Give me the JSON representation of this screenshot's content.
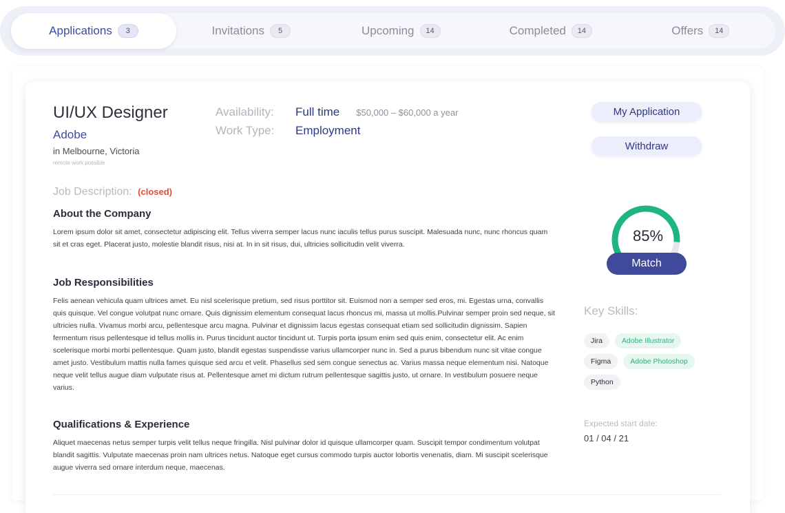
{
  "tabs": [
    {
      "label": "Applications",
      "count": "3"
    },
    {
      "label": "Invitations",
      "count": "5"
    },
    {
      "label": "Upcoming",
      "count": "14"
    },
    {
      "label": "Completed",
      "count": "14"
    },
    {
      "label": "Offers",
      "count": "14"
    }
  ],
  "job": {
    "title": "UI/UX Designer",
    "company": "Adobe",
    "location": "in Melbourne, Victoria",
    "remote_note": "remote work possible",
    "availability_label": "Availability:",
    "availability_value": "Full time",
    "salary": "$50,000 – $60,000 a year",
    "work_type_label": "Work Type:",
    "work_type_value": "Employment"
  },
  "actions": {
    "my_application": "My Application",
    "withdraw": "Withdraw"
  },
  "description": {
    "heading": "Job Description:",
    "status": "(closed)",
    "sections": [
      {
        "title": "About the Company",
        "text": "Lorem ipsum dolor sit amet, consectetur adipiscing elit. Tellus viverra semper lacus nunc iaculis tellus purus suscipit. Malesuada nunc, nunc rhoncus quam sit et cras eget. Placerat justo, molestie blandit risus, nisi at. In in sit risus, dui, ultricies sollicitudin velit viverra."
      },
      {
        "title": "Job Responsibilities",
        "text": "Felis aenean vehicula quam ultrices amet. Eu nisl scelerisque pretium, sed risus porttitor sit. Euismod non a semper sed eros, mi. Egestas urna, convallis quis quisque. Vel congue volutpat nunc ornare. Quis dignissim elementum consequat lacus rhoncus mi, massa ut mollis.Pulvinar semper proin sed neque, sit ultricies nulla. Vivamus morbi arcu, pellentesque arcu magna. Pulvinar et dignissim lacus egestas consequat etiam sed sollicitudin dignissim. Sapien fermentum risus pellentesque id tellus mollis in. Purus tincidunt auctor tincidunt ut. Turpis porta ipsum enim sed quis enim, consectetur elit. Ac enim scelerisque morbi morbi pellentesque. Quam justo, blandit egestas suspendisse varius ullamcorper nunc in. Sed a purus bibendum nunc sit vitae congue amet justo. Vestibulum mattis nulla fames quisque sed arcu et velit. Phasellus sed sem congue senectus ac. Varius massa neque elementum nisi. Natoque neque velit tellus augue diam vulputate risus at. Pellentesque amet mi dictum rutrum pellentesque sagittis justo, ut ornare. In vestibulum posuere neque varius."
      },
      {
        "title": "Qualifications & Experience",
        "text": "Aliquet maecenas netus semper turpis velit tellus neque fringilla. Nisl pulvinar dolor id quisque ullamcorper quam. Suscipit tempor condimentum volutpat blandit sagittis. Vulputate maecenas proin nam ultrices netus. Natoque eget cursus commodo turpis auctor lobortis venenatis, diam. Mi suscipit scelerisque augue viverra sed ornare interdum neque, maecenas."
      }
    ]
  },
  "match": {
    "percent_label": "85%",
    "fraction": 0.85,
    "label": "Match",
    "arc_color": "#1fb486",
    "track_color": "#e6e7ec"
  },
  "skills": {
    "heading": "Key Skills:",
    "rows": [
      [
        {
          "name": "Jira",
          "highlight": false
        },
        {
          "name": "Adobe Illustrator",
          "highlight": true
        }
      ],
      [
        {
          "name": "Figma",
          "highlight": false
        },
        {
          "name": "Adobe Photoshop",
          "highlight": true
        }
      ],
      [
        {
          "name": "Python",
          "highlight": false
        }
      ]
    ]
  },
  "start": {
    "label": "Expected start date:",
    "value": "01 / 04 / 21"
  }
}
